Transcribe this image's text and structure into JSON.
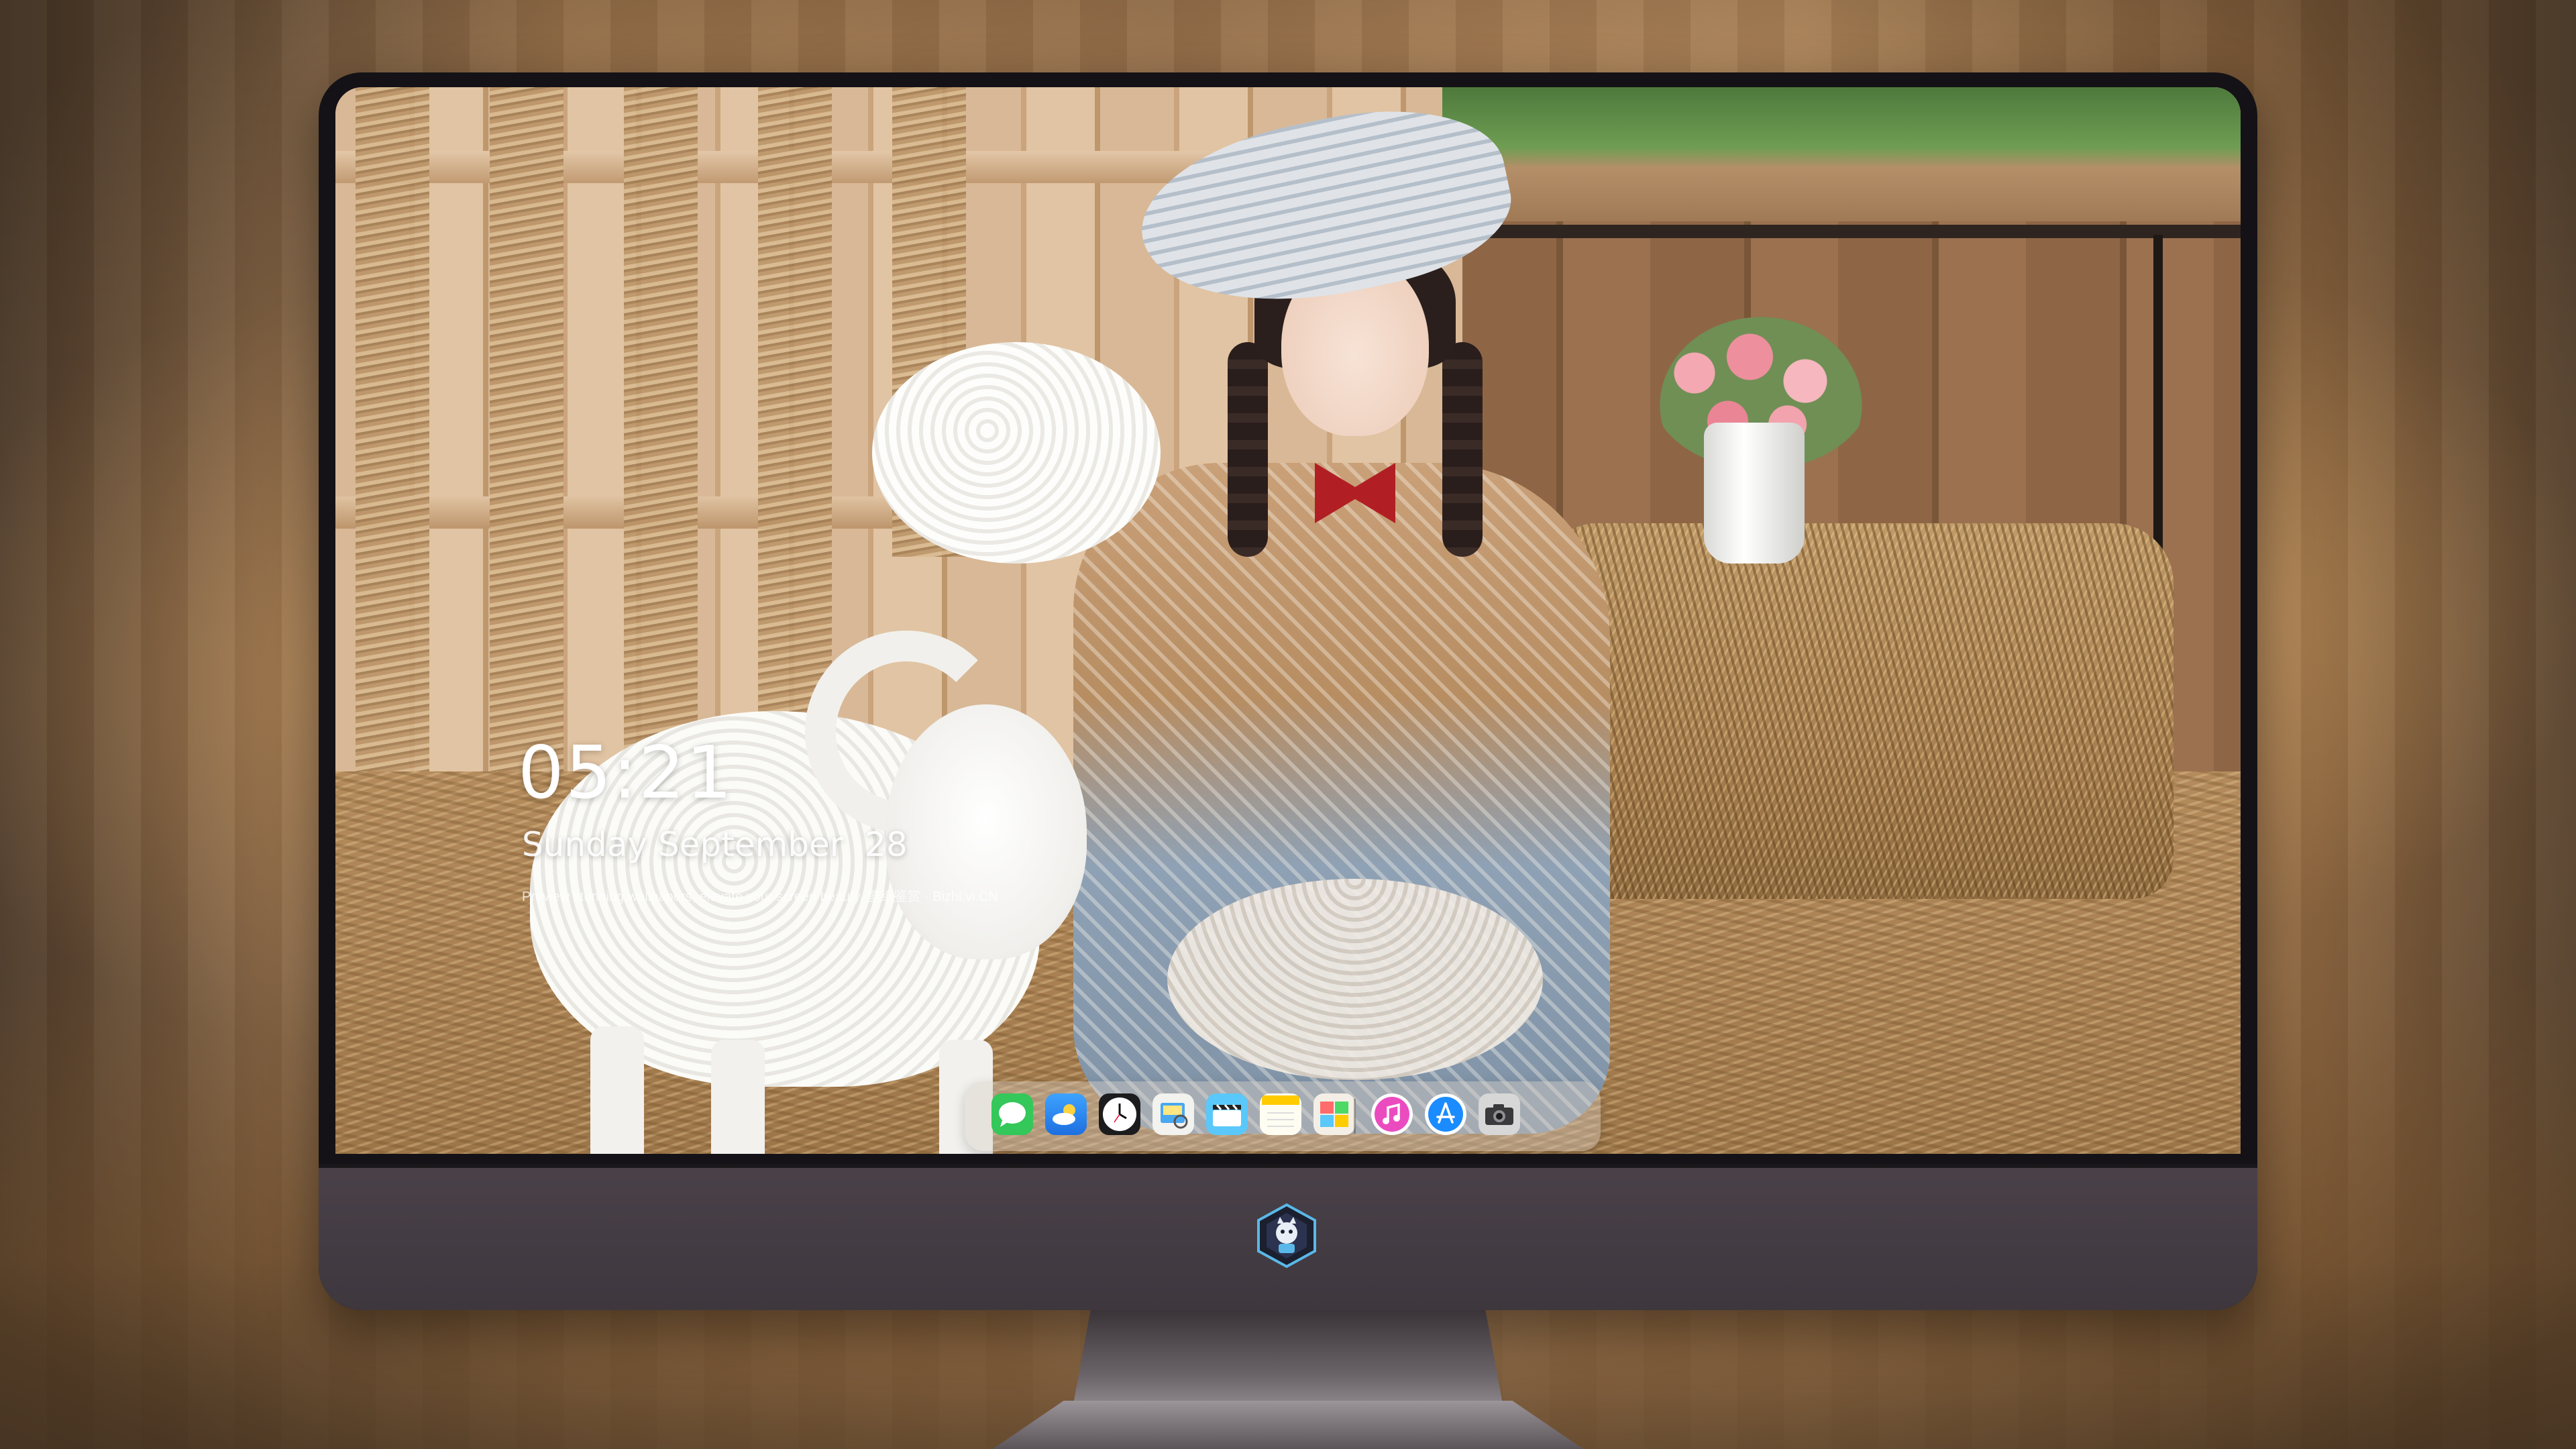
{
  "lockscreen": {
    "time": "05:21",
    "date": "Sunday September  28",
    "caption": "Preview stunning wallpapers, elevate your screen beauty. 壁纸鉴赏 · Bizhi.vi.CN"
  },
  "dock": {
    "apps": [
      {
        "name": "Messages",
        "icon": "messages-icon"
      },
      {
        "name": "Weather",
        "icon": "weather-icon"
      },
      {
        "name": "Clock",
        "icon": "clock-icon"
      },
      {
        "name": "Preview",
        "icon": "preview-icon"
      },
      {
        "name": "Clips",
        "icon": "clapperboard-icon"
      },
      {
        "name": "Notes",
        "icon": "notes-icon"
      },
      {
        "name": "Photo Booth",
        "icon": "photo-booth-icon"
      },
      {
        "name": "Music",
        "icon": "music-icon"
      },
      {
        "name": "App Store",
        "icon": "app-store-icon"
      },
      {
        "name": "Camera",
        "icon": "camera-icon"
      }
    ]
  },
  "colors": {
    "bezel": "#141216",
    "chin": "#433b42",
    "accent_music": "#ea4cc0",
    "accent_appstore": "#1a8cff",
    "messages_green": "#34c759"
  }
}
